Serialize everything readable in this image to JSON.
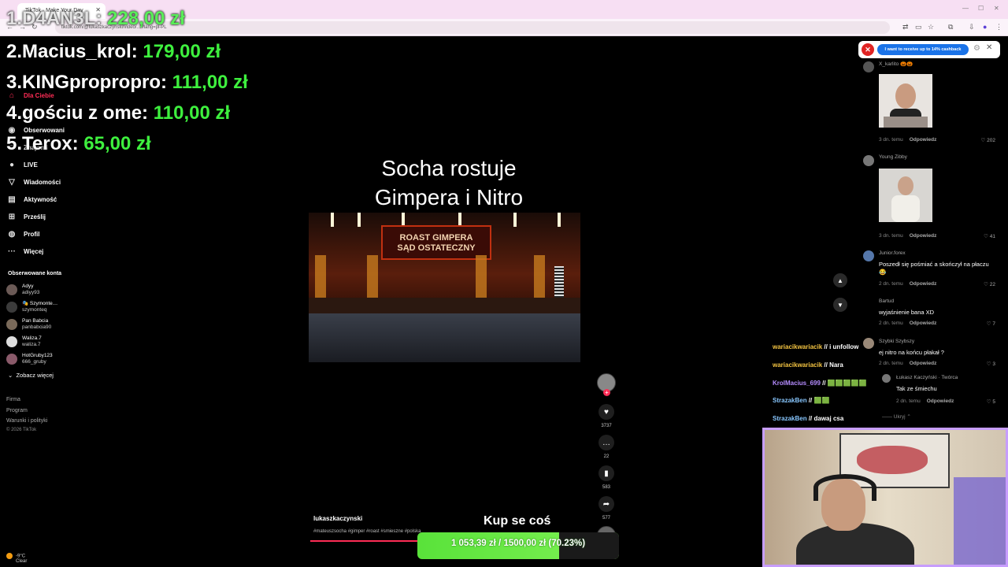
{
  "browser": {
    "tab_title": "TikTok · Make Your Day",
    "url": "tiktok.com/@lukaszkaczynski/video/…?lang=pl-PL",
    "window_controls": [
      "—",
      "☐",
      "✕"
    ]
  },
  "leaderboard": [
    {
      "rank_name": "1.D4AN3L:",
      "amount": "228,00 zł"
    },
    {
      "rank_name": "2.Macius_krol:",
      "amount": "179,00 zł"
    },
    {
      "rank_name": "3.KINGpropropro:",
      "amount": "111,00 zł"
    },
    {
      "rank_name": "4.gościu z ome:",
      "amount": "110,00 zł"
    },
    {
      "rank_name": "5.Terox:",
      "amount": "65,00 zł"
    }
  ],
  "nav": {
    "items": [
      {
        "label": "Dla Ciebie",
        "icon": "home-icon"
      },
      {
        "label": "Obserwowani",
        "icon": "following-icon"
      },
      {
        "label": "Znajomi",
        "icon": "friends-icon"
      },
      {
        "label": "LIVE",
        "icon": "live-icon"
      },
      {
        "label": "Wiadomości",
        "icon": "messages-icon"
      },
      {
        "label": "Aktywność",
        "icon": "activity-icon"
      },
      {
        "label": "Prześlij",
        "icon": "upload-icon"
      },
      {
        "label": "Profil",
        "icon": "profile-icon"
      },
      {
        "label": "Więcej",
        "icon": "more-icon"
      }
    ],
    "following_title": "Obserwowane konta",
    "following": [
      {
        "name": "Adyy",
        "handle": "adiyy93"
      },
      {
        "name": "🎭 Szymonte…",
        "handle": "szymonteq"
      },
      {
        "name": "Pan Babcia",
        "handle": "panbabcia90"
      },
      {
        "name": "Waliza.7",
        "handle": "waliza.7"
      },
      {
        "name": "HotGruby123",
        "handle": "666_gruby"
      }
    ],
    "see_more": "Zobacz więcej",
    "footer": [
      "Firma",
      "Program",
      "Warunki i polityki"
    ],
    "copyright": "© 2026 TikTok"
  },
  "video": {
    "title_line1": "Socha rostuje",
    "title_line2": "Gimpera i Nitro",
    "banner_line1": "ROAST GIMPERA",
    "banner_line2": "SĄD OSTATECZNY",
    "author": "lukaszkaczynski",
    "tags": "#mateuszsocha #gimper #roast #smieszne #polska",
    "likes": "3737",
    "comments": "22",
    "saves": "583",
    "shares": "577"
  },
  "donation_goal": {
    "label": "Kup se coś",
    "current": "1 053,39 zł",
    "target": "1500,00 zł",
    "percent_text": "(70.23%)",
    "progress": 0.7023
  },
  "cashback": {
    "text": "I want to receive up to 14% cashback"
  },
  "comments": [
    {
      "user": "X_karlito 🎃🎃",
      "text": "",
      "meta": "3 dn. temu",
      "reply": "Odpowiedz",
      "likes": "♡ 202",
      "has_image": true
    },
    {
      "user": "Young Zibby",
      "text": "",
      "meta": "3 dn. temu",
      "reply": "Odpowiedz",
      "likes": "♡ 41",
      "has_image": true
    },
    {
      "user": "Junior.forex",
      "text": "Poszedł się pośmiać a skończył na płaczu 😂",
      "meta": "2 dn. temu",
      "reply": "Odpowiedz",
      "likes": "♡ 22"
    },
    {
      "user": "Bartud",
      "text": "wyjaśnienie bana XD",
      "meta": "2 dn. temu",
      "reply": "Odpowiedz",
      "likes": "♡ 7"
    },
    {
      "user": "Szybki Szybszy",
      "text": "ej nitro na końcu płakał ?",
      "meta": "2 dn. temu",
      "reply": "Odpowiedz",
      "likes": "♡ 3"
    }
  ],
  "reply": {
    "user": "Łukasz Kaczyński · Twórca",
    "text": "Tak ze śmiechu",
    "meta": "2 dn. temu",
    "reply": "Odpowiedz",
    "likes": "♡ 5",
    "hide": "—— Ukryj ⌃"
  },
  "chat": [
    {
      "user": "wariacikwariacik",
      "sep": "//",
      "msg": "i unfollow"
    },
    {
      "user": "wariacikwariacik",
      "sep": "//",
      "msg": "Nara"
    },
    {
      "user": "KrolMacius_699",
      "sep": "//",
      "msg": "🟩🟩🟩🟩🟩"
    },
    {
      "user": "StrazakBen",
      "sep": "//",
      "msg": "🟩🟩"
    },
    {
      "user": "StrazakBen",
      "sep": "//",
      "msg": "dawaj csa"
    }
  ],
  "weather": {
    "temp": "-9°C",
    "condition": "Clear"
  },
  "colors": {
    "accent": "#fe2c55",
    "leader_amount": "#3ef03e",
    "goal_bar": "#59e23a",
    "cam_border": "#c79dfd"
  }
}
